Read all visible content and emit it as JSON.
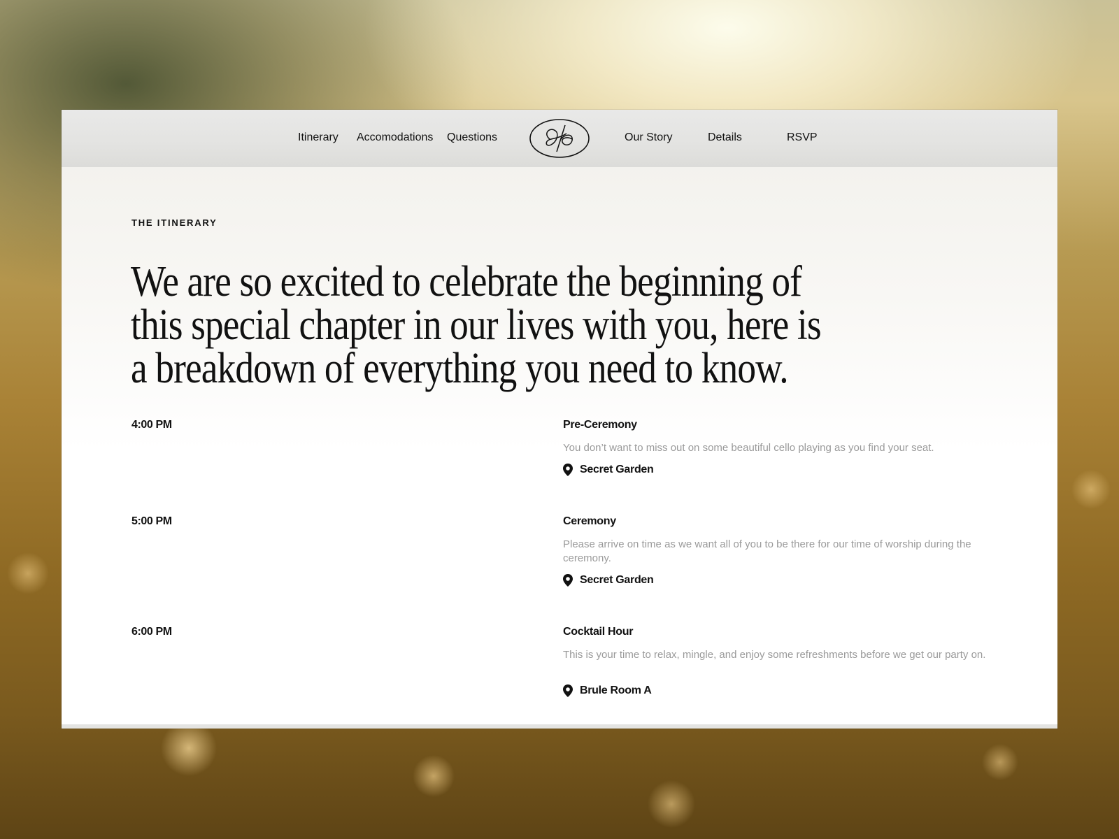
{
  "nav": {
    "left_links": [
      "Itinerary",
      "Accomodations",
      "Questions"
    ],
    "right_links": [
      "Our Story",
      "Details",
      "RSVP"
    ],
    "logo_icon": "monogram-logo-icon"
  },
  "section": {
    "eyebrow": "THE ITINERARY",
    "headline_lines": [
      "We are so excited to celebrate the beginning of",
      "this special chapter in our lives with you, here is",
      "a breakdown of everything you need to know."
    ]
  },
  "events": [
    {
      "time": "4:00 PM",
      "title": "Pre-Ceremony",
      "description": "You don’t want to miss out on some beautiful cello playing as you find your seat.",
      "location": "Secret Garden"
    },
    {
      "time": "5:00 PM",
      "title": "Ceremony",
      "description": "Please arrive on time as we want all of you to be there for our time of worship during the ceremony.",
      "location": "Secret Garden"
    },
    {
      "time": "6:00 PM",
      "title": "Cocktail Hour",
      "description": "This is your time to relax, mingle, and enjoy some refreshments before we get our party on.",
      "location": "Brule Room A"
    }
  ],
  "icons": {
    "location": "map-pin-icon"
  },
  "colors": {
    "text": "#111111",
    "muted": "#9a9a9a",
    "nav_bg": "#e3e3e1"
  }
}
